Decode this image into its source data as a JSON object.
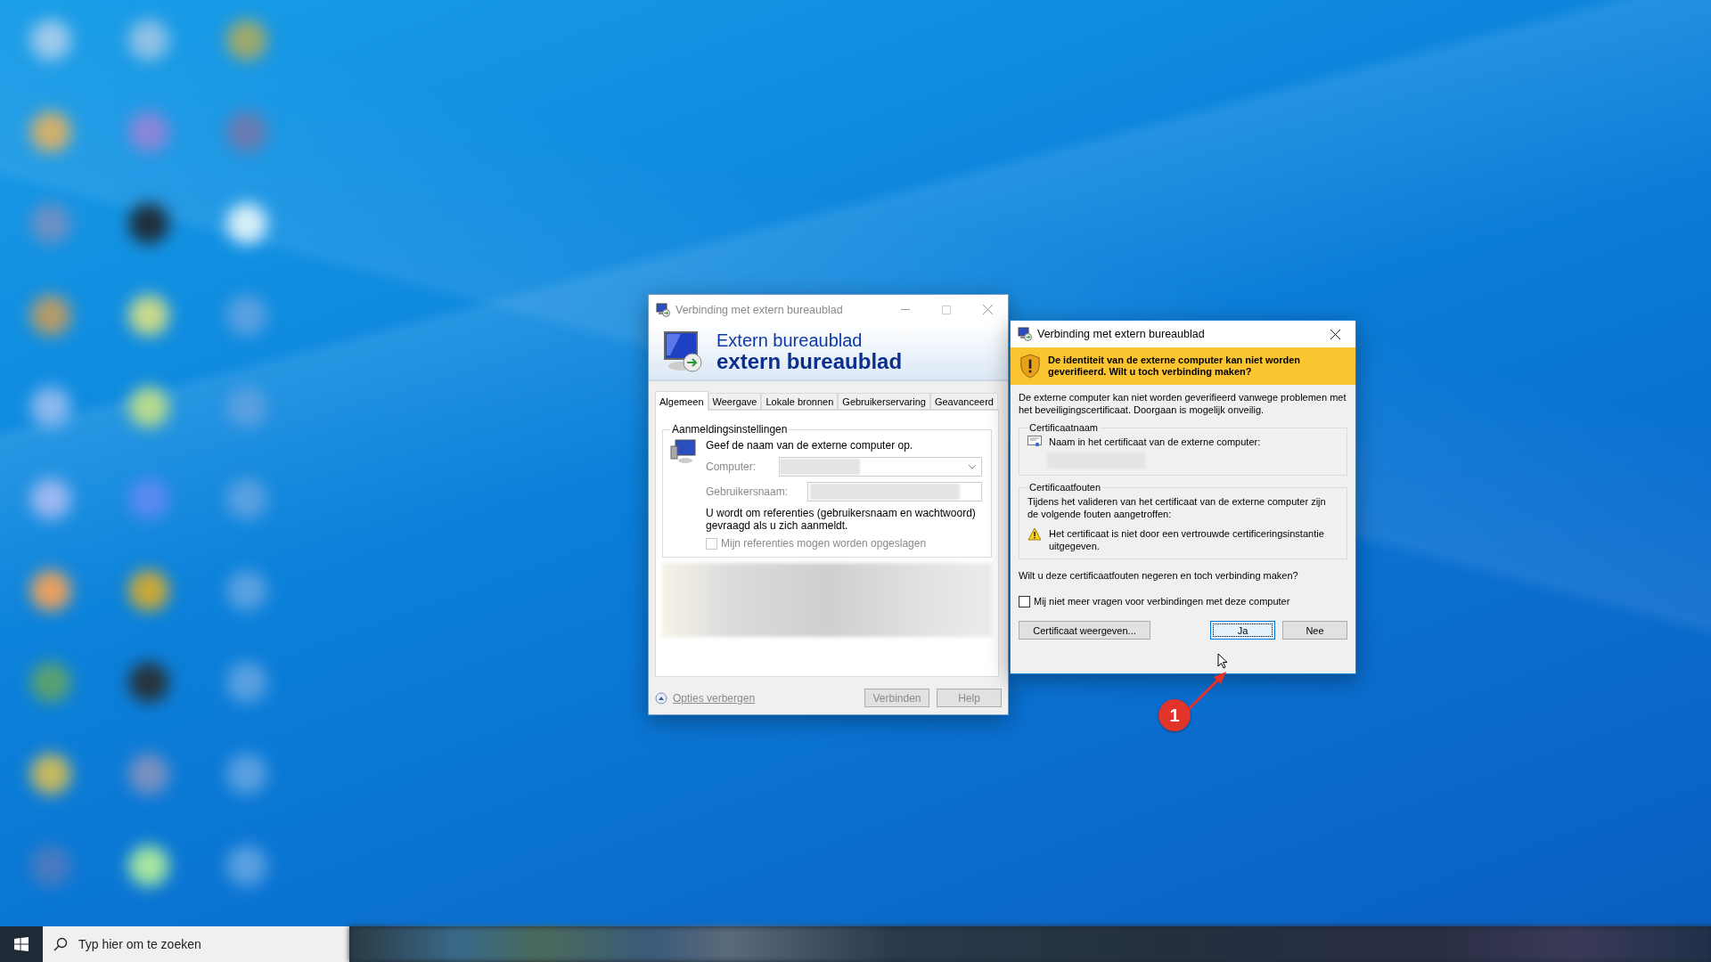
{
  "rdp_window": {
    "title": "Verbinding met extern bureaublad",
    "active": false,
    "header_line_1": "Extern bureaublad",
    "header_line_2": "extern bureaublad",
    "tabs": [
      {
        "label": "Algemeen",
        "selected": true
      },
      {
        "label": "Weergave",
        "selected": false
      },
      {
        "label": "Lokale bronnen",
        "selected": false
      },
      {
        "label": "Gebruikerservaring",
        "selected": false
      },
      {
        "label": "Geavanceerd",
        "selected": false
      }
    ],
    "group_title": "Aanmeldingsinstellingen",
    "prompt": "Geef de naam van de externe computer op.",
    "computer_label": "Computer:",
    "username_label": "Gebruikersnaam:",
    "info": "U wordt om referenties (gebruikersnaam en wachtwoord) gevraagd als u zich aanmeldt.",
    "save_checkbox": {
      "label": "Mijn referenties mogen worden opgeslagen",
      "checked": false
    },
    "options_link": "Opties verbergen",
    "buttons": [
      {
        "label": "Verbinden"
      },
      {
        "label": "Help"
      }
    ]
  },
  "cert_dialog": {
    "title": "Verbinding met extern bureaublad",
    "warning": "De identiteit van de externe computer kan niet worden geverifieerd. Wilt u toch verbinding maken?",
    "description": "De externe computer kan niet worden geverifieerd vanwege problemen met het beveiligingscertificaat. Doorgaan is mogelijk onveilig.",
    "cert_name_group": "Certificaatnaam",
    "cert_name_label": "Naam in het certificaat van de externe computer:",
    "cert_errors_group": "Certificaatfouten",
    "errors_intro": "Tijdens het valideren van het certificaat van de externe computer zijn de volgende fouten aangetroffen:",
    "errors": [
      "Het certificaat is niet door een vertrouwde certificeringsinstantie uitgegeven."
    ],
    "question": "Wilt u deze certificaatfouten negeren en toch verbinding maken?",
    "dont_ask": {
      "label": "Mij niet meer vragen voor verbindingen met deze computer",
      "checked": false
    },
    "buttons": [
      {
        "label": "Certificaat weergeven...",
        "focused": false
      },
      {
        "label": "Ja",
        "focused": true
      },
      {
        "label": "Nee",
        "focused": false
      }
    ]
  },
  "annotation": {
    "label": "1"
  },
  "taskbar": {
    "search_placeholder": "Typ hier om te zoeken"
  }
}
